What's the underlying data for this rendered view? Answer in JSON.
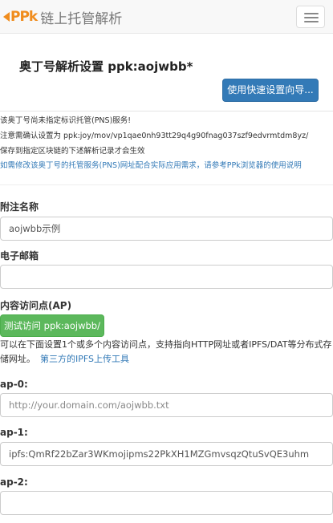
{
  "navbar": {
    "logo_text": "PPk",
    "title": "链上托管解析",
    "menu_icon": "hamburger-icon"
  },
  "header": {
    "title": "奥丁号解析设置 ppk:aojwbb*",
    "wizard_button": "使用快速设置向导..."
  },
  "notices": {
    "line1": "该奥丁号尚未指定标识托管(PNS)服务!",
    "line2": "注意需确认设置为 ppk:joy/mov/vp1qae0nh93tt29q4g90fnag037szf9edvrmtdm8yz/",
    "line3": "保存到指定区块链的下述解析记录才会生效",
    "link": "如需修改该奥丁号的托管服务(PNS)网址配合实际应用需求，请参考PPk浏览器的使用说明"
  },
  "form": {
    "note_label": "附注名称",
    "note_value": "aojwbb示例",
    "email_label": "电子邮箱",
    "email_value": "",
    "ap_label": "内容访问点(AP)",
    "test_button": "测试访问 ppk:aojwbb/",
    "ap_desc": "可以在下面设置1个或多个内容访问点，支持指向HTTP网址或者IPFS/DAT等分布式存储网址。",
    "ap_tool_link": "第三方的IPFS上传工具",
    "ap0_label": "ap-0:",
    "ap0_value": "http://your.domain.com/aojwbb.txt",
    "ap1_label": "ap-1:",
    "ap1_value": "ipfs:QmRf22bZar3WKmojipms22PkXH1MZGmvsqzQtuSvQE3uhm",
    "ap2_label": "ap-2:",
    "ap2_value": ""
  },
  "colors": {
    "brand_orange": "#f08c1d",
    "primary": "#337ab7",
    "success": "#5cb85c"
  }
}
